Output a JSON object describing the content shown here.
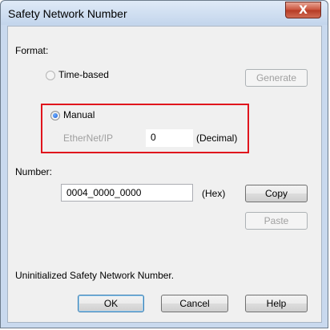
{
  "window": {
    "title": "Safety Network Number",
    "close_glyph": "X"
  },
  "format": {
    "label": "Format:",
    "time_based_label": "Time-based",
    "generate_label": "Generate",
    "manual_label": "Manual",
    "selected": "Manual",
    "ethernet_label": "EtherNet/IP",
    "decimal_value": "0",
    "decimal_unit": "(Decimal)"
  },
  "number": {
    "label": "Number:",
    "value": "0004_0000_0000",
    "unit": "(Hex)",
    "copy_label": "Copy",
    "paste_label": "Paste"
  },
  "status": {
    "message": "Uninitialized Safety Network Number."
  },
  "buttons": {
    "ok": "OK",
    "cancel": "Cancel",
    "help": "Help"
  },
  "colors": {
    "highlight_border": "#e0151d",
    "dialog_background": "#f0f0f0",
    "titlebar": "#c9d9ee"
  }
}
